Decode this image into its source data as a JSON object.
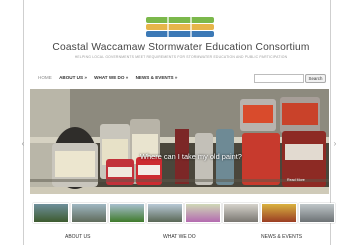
{
  "site": {
    "title": "Coastal Waccamaw Stormwater Education Consortium",
    "tagline": "HELPING LOCAL GOVERNMENTS MEET REQUIREMENTS FOR STORMWATER EDUCATION AND PUBLIC PARTICIPATION"
  },
  "nav": {
    "items": [
      {
        "label": "HOME"
      },
      {
        "label": "ABOUT US »"
      },
      {
        "label": "WHAT WE DO »"
      },
      {
        "label": "NEWS & EVENTS »"
      }
    ]
  },
  "search": {
    "placeholder": "",
    "button_label": "Search"
  },
  "slider": {
    "caption": "Where can I take my old paint?",
    "read_more": "Read More",
    "prev_icon": "chevron-left-icon",
    "next_icon": "chevron-right-icon"
  },
  "sections": [
    {
      "label": "ABOUT US"
    },
    {
      "label": "WHAT WE DO"
    },
    {
      "label": "NEWS & EVENTS"
    }
  ],
  "colors": {
    "logo_green": "#7bb84b",
    "logo_yellow": "#e6b54a",
    "logo_blue": "#3c79b6"
  }
}
